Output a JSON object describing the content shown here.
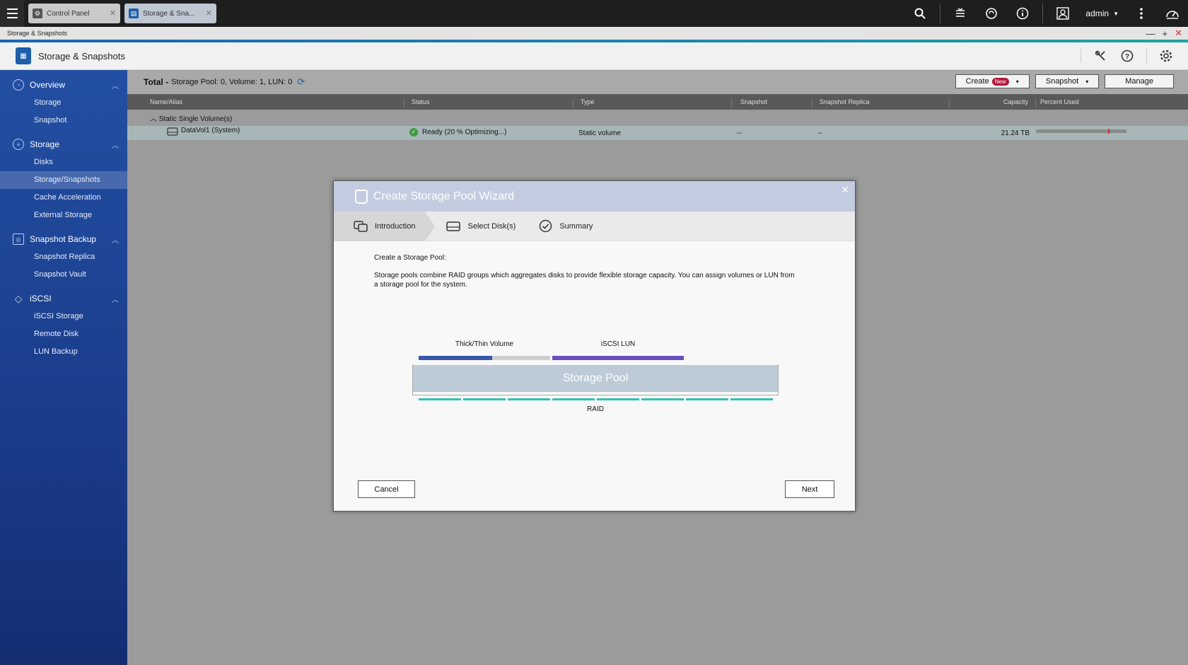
{
  "taskbar": {
    "tabs": [
      {
        "label": "Control Panel",
        "icon": "gear-icon"
      },
      {
        "label": "Storage & Sna...",
        "icon": "storage-icon"
      }
    ],
    "user": "admin"
  },
  "window": {
    "strip_title": "Storage & Snapshots",
    "app_title": "Storage & Snapshots"
  },
  "sidebar": {
    "groups": [
      {
        "label": "Overview",
        "items": [
          "Storage",
          "Snapshot"
        ]
      },
      {
        "label": "Storage",
        "items": [
          "Disks",
          "Storage/Snapshots",
          "Cache Acceleration",
          "External Storage"
        ]
      },
      {
        "label": "Snapshot Backup",
        "items": [
          "Snapshot Replica",
          "Snapshot Vault"
        ]
      },
      {
        "label": "iSCSI",
        "items": [
          "iSCSI Storage",
          "Remote Disk",
          "LUN Backup"
        ]
      }
    ],
    "active_item": "Storage/Snapshots"
  },
  "summary": {
    "total_label": "Total -",
    "text": "Storage Pool: 0, Volume: 1, LUN: 0"
  },
  "toolbar": {
    "create_label": "Create",
    "new_badge": "New",
    "snapshot_label": "Snapshot",
    "manage_label": "Manage"
  },
  "table": {
    "columns": [
      "Name/Alias",
      "Status",
      "Type",
      "Snapshot",
      "Snapshot Replica",
      "Capacity",
      "Percent Used"
    ],
    "group_label": "Static Single Volume(s)",
    "row": {
      "name": "DataVol1 (System)",
      "status": "Ready (20 % Optimizing...)",
      "type": "Static volume",
      "snapshot": "--",
      "replica": "--",
      "capacity": "21.24 TB",
      "percent_used": 0.8
    }
  },
  "dialog": {
    "title": "Create Storage Pool Wizard",
    "steps": [
      "Introduction",
      "Select Disk(s)",
      "Summary"
    ],
    "heading": "Create a Storage Pool:",
    "description": "Storage pools combine RAID groups which aggregates disks to provide flexible storage capacity. You can assign volumes or LUN from a storage pool for the system.",
    "diagram": {
      "volume_label": "Thick/Thin Volume",
      "lun_label": "iSCSI LUN",
      "pool_label": "Storage Pool",
      "raid_label": "RAID"
    },
    "cancel_label": "Cancel",
    "next_label": "Next"
  },
  "colors": {
    "accent": "#1d5fa8",
    "sidebar_top": "#234fa3",
    "volume_bar": "#3a56a8",
    "lun_bar": "#6b4fbe",
    "raid": "#2cc4b4",
    "new_badge": "#b2163b"
  }
}
